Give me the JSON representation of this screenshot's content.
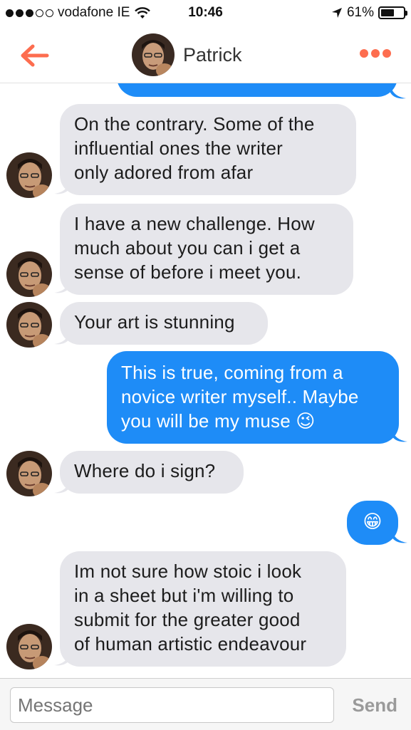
{
  "status_bar": {
    "carrier": "vodafone IE",
    "time": "10:46",
    "battery_percent": "61%",
    "battery_level": 0.61,
    "icons": [
      "signal-dots",
      "wifi-icon",
      "location-arrow-icon",
      "battery-icon"
    ]
  },
  "header": {
    "contact_name": "Patrick",
    "icons": [
      "back-arrow-icon",
      "more-dots-icon"
    ],
    "accent_color": "#fd6d4f"
  },
  "messages": [
    {
      "from": "me",
      "text": "",
      "partial": true
    },
    {
      "from": "Patrick",
      "lines": [
        "On the contrary. Some of the",
        "influential ones the writer",
        "only adored from afar"
      ]
    },
    {
      "from": "Patrick",
      "lines": [
        "I have a new challenge. How",
        "much about you can i get a",
        "sense of before i meet you."
      ]
    },
    {
      "from": "Patrick",
      "lines": [
        "Your art is stunning"
      ]
    },
    {
      "from": "me",
      "lines": [
        "This is true, coming from a",
        "novice writer myself.. Maybe",
        "you will be my muse 😉"
      ]
    },
    {
      "from": "Patrick",
      "lines": [
        "Where do i sign?"
      ]
    },
    {
      "from": "me",
      "lines": [
        "😁"
      ]
    },
    {
      "from": "Patrick",
      "lines": [
        "Im not sure how stoic i look",
        "in a sheet but i'm willing to",
        "submit for the greater good",
        "of human artistic endeavour"
      ]
    }
  ],
  "input": {
    "placeholder": "Message",
    "send_label": "Send"
  },
  "colors": {
    "incoming_bubble": "#e6e6eb",
    "outgoing_bubble": "#1e8cf7"
  }
}
